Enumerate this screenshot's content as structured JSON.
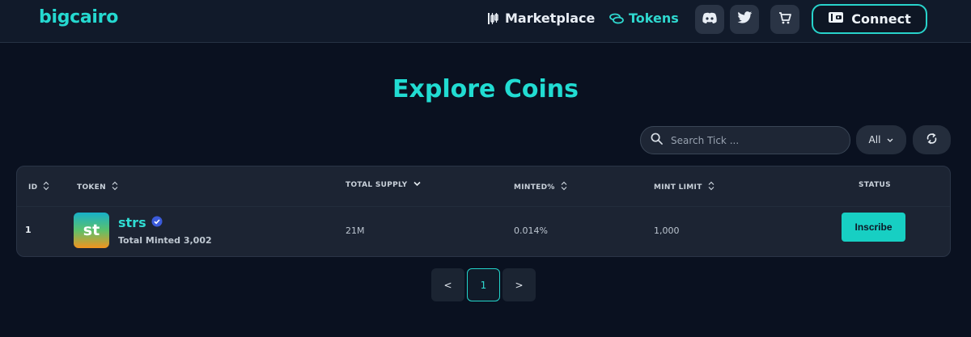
{
  "header": {
    "logo": "bigcairo",
    "nav": [
      {
        "label": "Marketplace",
        "icon": "chart-candles-icon"
      },
      {
        "label": "Tokens",
        "icon": "coins-icon"
      }
    ],
    "icons": [
      "discord-icon",
      "twitter-icon",
      "cart-icon"
    ],
    "connect_label": "Connect"
  },
  "main": {
    "title": "Explore Coins",
    "search": {
      "placeholder": "Search Tick ...",
      "value": ""
    },
    "filter": {
      "selected": "All"
    },
    "table": {
      "columns": [
        "ID",
        "TOKEN",
        "TOTAL SUPPLY",
        "MINTED%",
        "MINT LIMIT",
        "STATUS"
      ],
      "rows": [
        {
          "id": "1",
          "avatar_text": "st",
          "name": "strs",
          "verified": true,
          "total_minted": "Total Minted 3,002",
          "total_supply": "21M",
          "minted_pct": "0.014%",
          "mint_limit": "1,000",
          "action": "Inscribe"
        }
      ]
    },
    "pagination": {
      "prev": "<",
      "current": "1",
      "next": ">"
    }
  },
  "colors": {
    "accent": "#21dcd2",
    "background": "#0a1120",
    "card": "#1c2433",
    "verified": "#3b5bdb"
  }
}
